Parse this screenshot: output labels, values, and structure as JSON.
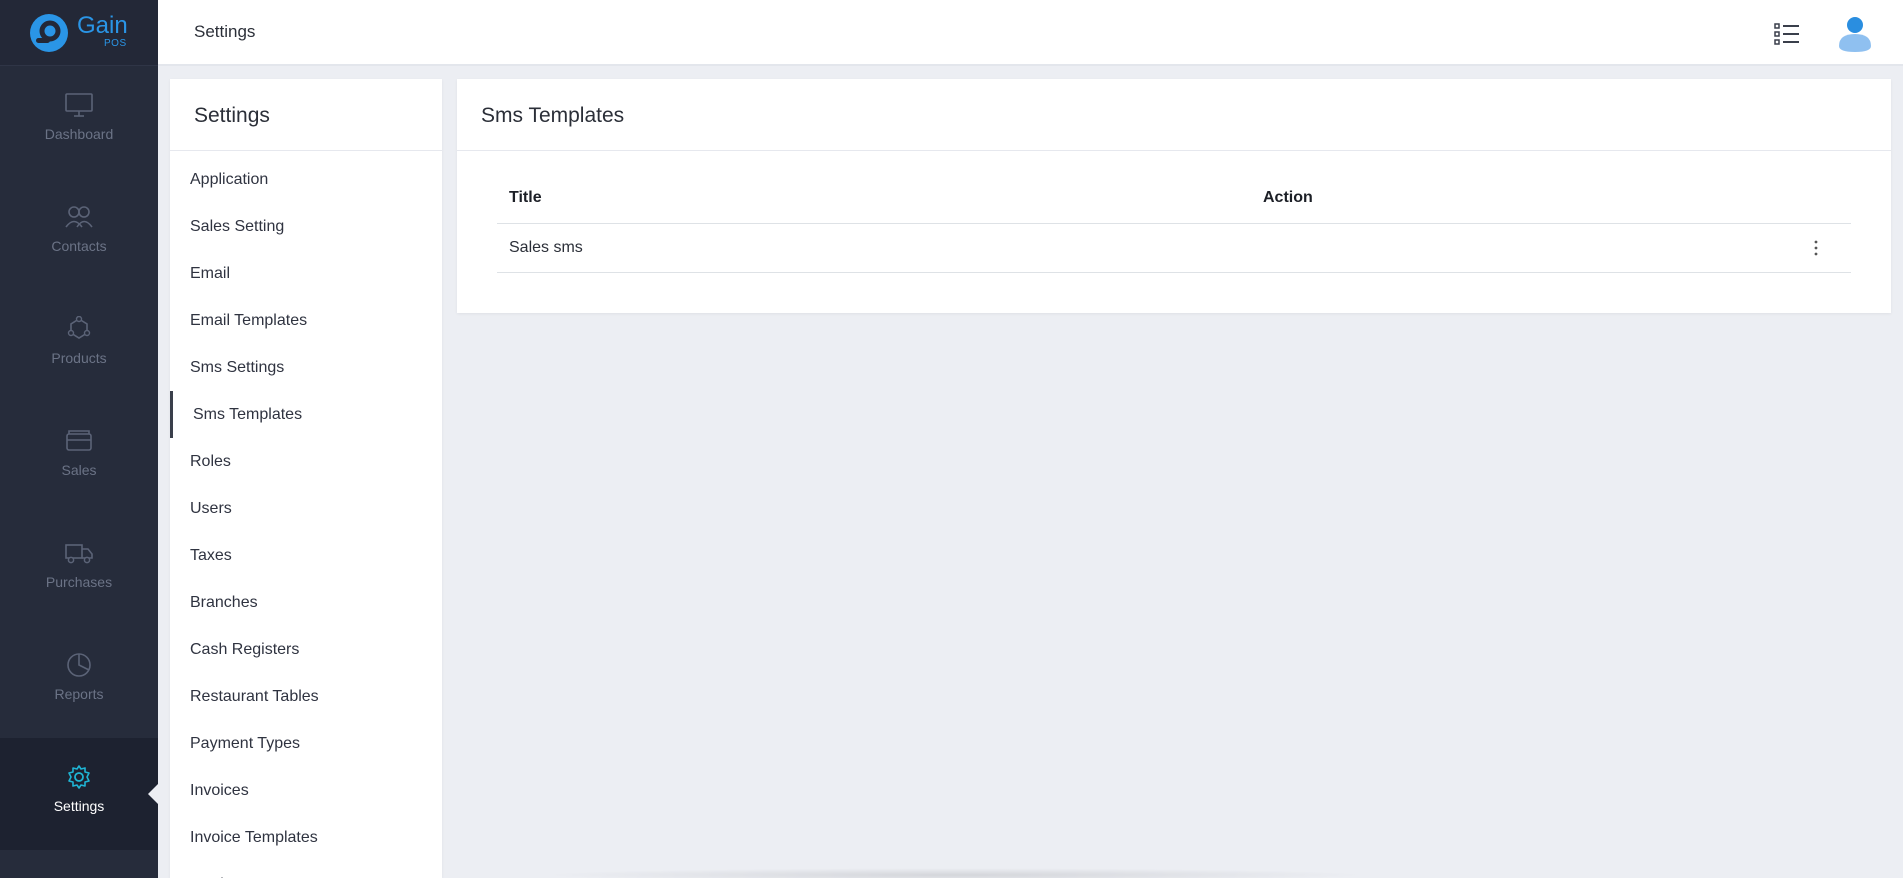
{
  "brand": {
    "name": "Gain",
    "sub": "POS",
    "color": "#2a95e6"
  },
  "nav": [
    {
      "label": "Dashboard",
      "icon": "monitor-icon"
    },
    {
      "label": "Contacts",
      "icon": "users-icon"
    },
    {
      "label": "Products",
      "icon": "cubes-icon"
    },
    {
      "label": "Sales",
      "icon": "wallet-icon"
    },
    {
      "label": "Purchases",
      "icon": "truck-icon"
    },
    {
      "label": "Reports",
      "icon": "pie-chart-icon"
    },
    {
      "label": "Settings",
      "icon": "gear-icon",
      "active": true
    }
  ],
  "header": {
    "title": "Settings"
  },
  "settings": {
    "title": "Settings",
    "items": [
      "Application",
      "Sales Setting",
      "Email",
      "Email Templates",
      "Sms Settings",
      "Sms Templates",
      "Roles",
      "Users",
      "Taxes",
      "Branches",
      "Cash Registers",
      "Restaurant Tables",
      "Payment Types",
      "Invoices",
      "Invoice Templates",
      "Products"
    ],
    "active": "Sms Templates"
  },
  "card": {
    "title": "Sms Templates",
    "columns": {
      "title": "Title",
      "action": "Action"
    },
    "rows": [
      {
        "title": "Sales sms"
      }
    ]
  },
  "colors": {
    "sidebar": "#262c3b",
    "active_icon": "#1fb6d5",
    "background": "#eceef3"
  }
}
